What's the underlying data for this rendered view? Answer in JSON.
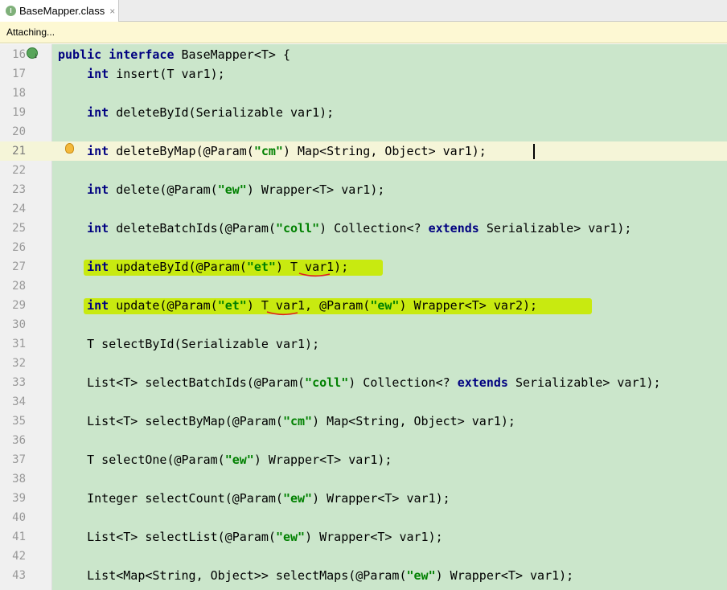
{
  "tab": {
    "title": "BaseMapper.class",
    "icon": "interface-icon",
    "close": "×"
  },
  "notice": {
    "text": "Attaching..."
  },
  "lines": [
    {
      "no": "16",
      "code": [
        [
          "kw",
          "public"
        ],
        [
          "t",
          " "
        ],
        [
          "kw",
          "interface"
        ],
        [
          "t",
          " BaseMapper<T> {"
        ]
      ]
    },
    {
      "no": "17",
      "code": [
        [
          "t",
          "    "
        ],
        [
          "kw",
          "int"
        ],
        [
          "t",
          " insert(T var1);"
        ]
      ]
    },
    {
      "no": "18",
      "code": []
    },
    {
      "no": "19",
      "code": [
        [
          "t",
          "    "
        ],
        [
          "kw",
          "int"
        ],
        [
          "t",
          " deleteById(Serializable var1);"
        ]
      ]
    },
    {
      "no": "20",
      "code": []
    },
    {
      "no": "21",
      "code": [
        [
          "t",
          "    "
        ],
        [
          "kw",
          "int"
        ],
        [
          "t",
          " deleteByMap(@Param("
        ],
        [
          "str",
          "\"cm\""
        ],
        [
          "t",
          ") Map<String, Object> var1);"
        ]
      ]
    },
    {
      "no": "22",
      "code": []
    },
    {
      "no": "23",
      "code": [
        [
          "t",
          "    "
        ],
        [
          "kw",
          "int"
        ],
        [
          "t",
          " delete(@Param("
        ],
        [
          "str",
          "\"ew\""
        ],
        [
          "t",
          ") Wrapper<T> var1);"
        ]
      ]
    },
    {
      "no": "24",
      "code": []
    },
    {
      "no": "25",
      "code": [
        [
          "t",
          "    "
        ],
        [
          "kw",
          "int"
        ],
        [
          "t",
          " deleteBatchIds(@Param("
        ],
        [
          "str",
          "\"coll\""
        ],
        [
          "t",
          ") Collection<? "
        ],
        [
          "kw",
          "extends"
        ],
        [
          "t",
          " Serializable> var1);"
        ]
      ]
    },
    {
      "no": "26",
      "code": []
    },
    {
      "no": "27",
      "code": [
        [
          "t",
          "    "
        ],
        [
          "kw",
          "int"
        ],
        [
          "t",
          " updateById(@Param("
        ],
        [
          "str",
          "\"et\""
        ],
        [
          "t",
          ") T var1);"
        ]
      ]
    },
    {
      "no": "28",
      "code": []
    },
    {
      "no": "29",
      "code": [
        [
          "t",
          "    "
        ],
        [
          "kw",
          "int"
        ],
        [
          "t",
          " update(@Param("
        ],
        [
          "str",
          "\"et\""
        ],
        [
          "t",
          ") T var1, @Param("
        ],
        [
          "str",
          "\"ew\""
        ],
        [
          "t",
          ") Wrapper<T> var2);"
        ]
      ]
    },
    {
      "no": "30",
      "code": []
    },
    {
      "no": "31",
      "code": [
        [
          "t",
          "    T selectById(Serializable var1);"
        ]
      ]
    },
    {
      "no": "32",
      "code": []
    },
    {
      "no": "33",
      "code": [
        [
          "t",
          "    List<T> selectBatchIds(@Param("
        ],
        [
          "str",
          "\"coll\""
        ],
        [
          "t",
          ") Collection<? "
        ],
        [
          "kw",
          "extends"
        ],
        [
          "t",
          " Serializable> var1);"
        ]
      ]
    },
    {
      "no": "34",
      "code": []
    },
    {
      "no": "35",
      "code": [
        [
          "t",
          "    List<T> selectByMap(@Param("
        ],
        [
          "str",
          "\"cm\""
        ],
        [
          "t",
          ") Map<String, Object> var1);"
        ]
      ]
    },
    {
      "no": "36",
      "code": []
    },
    {
      "no": "37",
      "code": [
        [
          "t",
          "    T selectOne(@Param("
        ],
        [
          "str",
          "\"ew\""
        ],
        [
          "t",
          ") Wrapper<T> var1);"
        ]
      ]
    },
    {
      "no": "38",
      "code": []
    },
    {
      "no": "39",
      "code": [
        [
          "t",
          "    Integer selectCount(@Param("
        ],
        [
          "str",
          "\"ew\""
        ],
        [
          "t",
          ") Wrapper<T> var1);"
        ]
      ]
    },
    {
      "no": "40",
      "code": []
    },
    {
      "no": "41",
      "code": [
        [
          "t",
          "    List<T> selectList(@Param("
        ],
        [
          "str",
          "\"ew\""
        ],
        [
          "t",
          ") Wrapper<T> var1);"
        ]
      ]
    },
    {
      "no": "42",
      "code": []
    },
    {
      "no": "43",
      "code": [
        [
          "t",
          "    List<Map<String, Object>> selectMaps(@Param("
        ],
        [
          "str",
          "\"ew\""
        ],
        [
          "t",
          ") Wrapper<T> var1);"
        ]
      ]
    }
  ],
  "colors": {
    "editor_bg": "#cbe6cb",
    "keyword": "#000080",
    "string": "#008000",
    "highlight": "#c8ea10",
    "squiggle": "#e02020"
  },
  "gutter_icons": {
    "line_16": "implemented-interface-icon",
    "line_21": "lightbulb-icon"
  }
}
